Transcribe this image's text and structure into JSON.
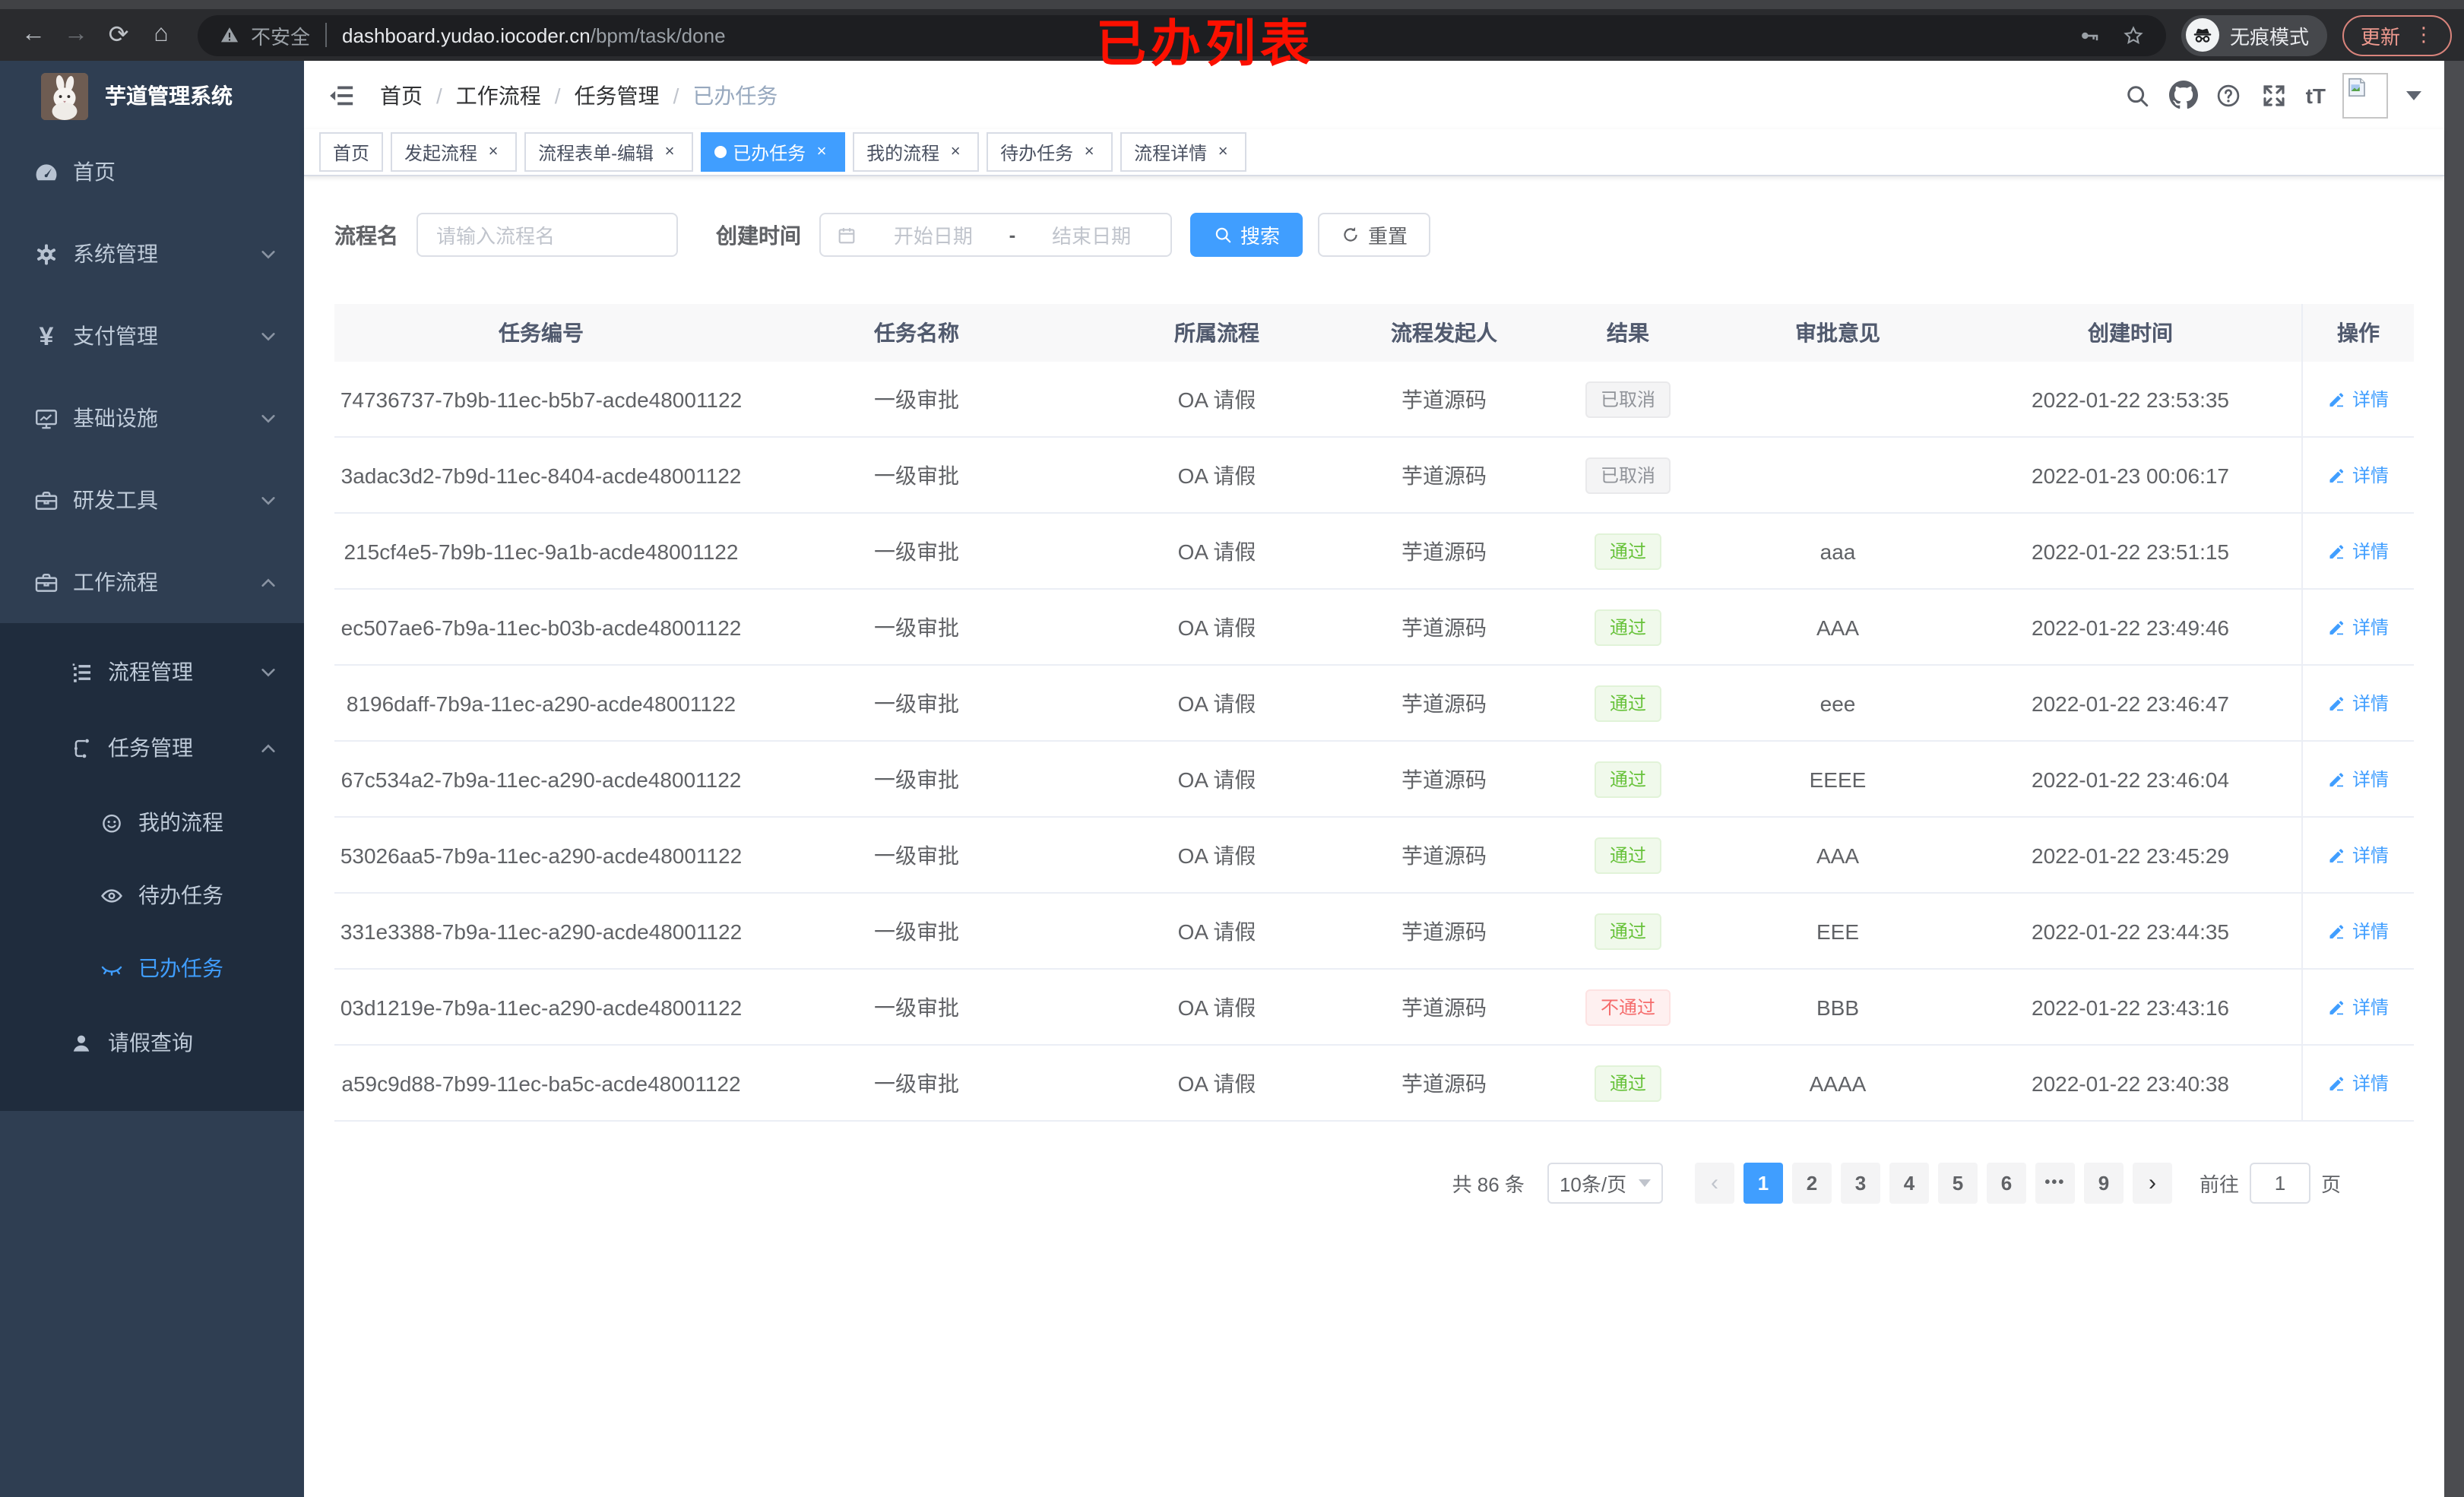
{
  "annotation": {
    "title": "已办列表"
  },
  "browser": {
    "security_label": "不安全",
    "url_domain": "dashboard.yudao.iocoder.cn",
    "url_path": "/bpm/task/done",
    "incognito_label": "无痕模式",
    "update_label": "更新"
  },
  "ui": {
    "close": "×",
    "sep": "/",
    "range_sep": "-",
    "kebab": "⋮",
    "ellipsis": "•••",
    "prev": "‹",
    "next": "›",
    "back": "←",
    "forward": "→",
    "reload": "⟳",
    "home": "⌂",
    "font_icon": "tT"
  },
  "sidebar": {
    "app_title": "芋道管理系统",
    "menu": [
      {
        "label": "首页",
        "icon": "dashboard-icon"
      },
      {
        "label": "系统管理",
        "icon": "gear-icon"
      },
      {
        "label": "支付管理",
        "icon": "yuan-icon",
        "glyph": "¥"
      },
      {
        "label": "基础设施",
        "icon": "monitor-icon"
      },
      {
        "label": "研发工具",
        "icon": "toolbox-icon"
      },
      {
        "label": "工作流程",
        "icon": "briefcase-icon"
      }
    ],
    "submenu": [
      {
        "label": "流程管理",
        "icon": "list-icon"
      },
      {
        "label": "任务管理",
        "icon": "flow-icon"
      }
    ],
    "task_items": [
      {
        "label": "我的流程",
        "icon": "robot-icon"
      },
      {
        "label": "待办任务",
        "icon": "eye-icon"
      },
      {
        "label": "已办任务",
        "icon": "eye-closed-icon"
      }
    ],
    "leave_item": {
      "label": "请假查询",
      "icon": "user-icon"
    }
  },
  "header": {
    "breadcrumb": [
      "首页",
      "工作流程",
      "任务管理",
      "已办任务"
    ]
  },
  "tabs": [
    {
      "label": "首页"
    },
    {
      "label": "发起流程"
    },
    {
      "label": "流程表单-编辑"
    },
    {
      "label": "已办任务"
    },
    {
      "label": "我的流程"
    },
    {
      "label": "待办任务"
    },
    {
      "label": "流程详情"
    }
  ],
  "filters": {
    "name_label": "流程名",
    "name_placeholder": "请输入流程名",
    "time_label": "创建时间",
    "start_placeholder": "开始日期",
    "end_placeholder": "结束日期",
    "search_label": "搜索",
    "reset_label": "重置"
  },
  "table": {
    "columns": [
      "任务编号",
      "任务名称",
      "所属流程",
      "流程发起人",
      "结果",
      "审批意见",
      "创建时间",
      "操作"
    ],
    "action_label": "详情",
    "rows": [
      {
        "id": "74736737-7b9b-11ec-b5b7-acde48001122",
        "name": "一级审批",
        "flow": "OA 请假",
        "starter": "芋道源码",
        "result": "已取消",
        "comment": "",
        "created": "2022-01-22 23:53:35"
      },
      {
        "id": "3adac3d2-7b9d-11ec-8404-acde48001122",
        "name": "一级审批",
        "flow": "OA 请假",
        "starter": "芋道源码",
        "result": "已取消",
        "comment": "",
        "created": "2022-01-23 00:06:17"
      },
      {
        "id": "215cf4e5-7b9b-11ec-9a1b-acde48001122",
        "name": "一级审批",
        "flow": "OA 请假",
        "starter": "芋道源码",
        "result": "通过",
        "comment": "aaa",
        "created": "2022-01-22 23:51:15"
      },
      {
        "id": "ec507ae6-7b9a-11ec-b03b-acde48001122",
        "name": "一级审批",
        "flow": "OA 请假",
        "starter": "芋道源码",
        "result": "通过",
        "comment": "AAA",
        "created": "2022-01-22 23:49:46"
      },
      {
        "id": "8196daff-7b9a-11ec-a290-acde48001122",
        "name": "一级审批",
        "flow": "OA 请假",
        "starter": "芋道源码",
        "result": "通过",
        "comment": "eee",
        "created": "2022-01-22 23:46:47"
      },
      {
        "id": "67c534a2-7b9a-11ec-a290-acde48001122",
        "name": "一级审批",
        "flow": "OA 请假",
        "starter": "芋道源码",
        "result": "通过",
        "comment": "EEEE",
        "created": "2022-01-22 23:46:04"
      },
      {
        "id": "53026aa5-7b9a-11ec-a290-acde48001122",
        "name": "一级审批",
        "flow": "OA 请假",
        "starter": "芋道源码",
        "result": "通过",
        "comment": "AAA",
        "created": "2022-01-22 23:45:29"
      },
      {
        "id": "331e3388-7b9a-11ec-a290-acde48001122",
        "name": "一级审批",
        "flow": "OA 请假",
        "starter": "芋道源码",
        "result": "通过",
        "comment": "EEE",
        "created": "2022-01-22 23:44:35"
      },
      {
        "id": "03d1219e-7b9a-11ec-a290-acde48001122",
        "name": "一级审批",
        "flow": "OA 请假",
        "starter": "芋道源码",
        "result": "不通过",
        "comment": "BBB",
        "created": "2022-01-22 23:43:16"
      },
      {
        "id": "a59c9d88-7b99-11ec-ba5c-acde48001122",
        "name": "一级审批",
        "flow": "OA 请假",
        "starter": "芋道源码",
        "result": "通过",
        "comment": "AAAA",
        "created": "2022-01-22 23:40:38"
      }
    ]
  },
  "pagination": {
    "total": "共 86 条",
    "size": "10条/页",
    "pages": [
      "1",
      "2",
      "3",
      "4",
      "5",
      "6"
    ],
    "last_page": "9",
    "goto_label": "前往",
    "goto_value": "1",
    "unit_label": "页"
  }
}
